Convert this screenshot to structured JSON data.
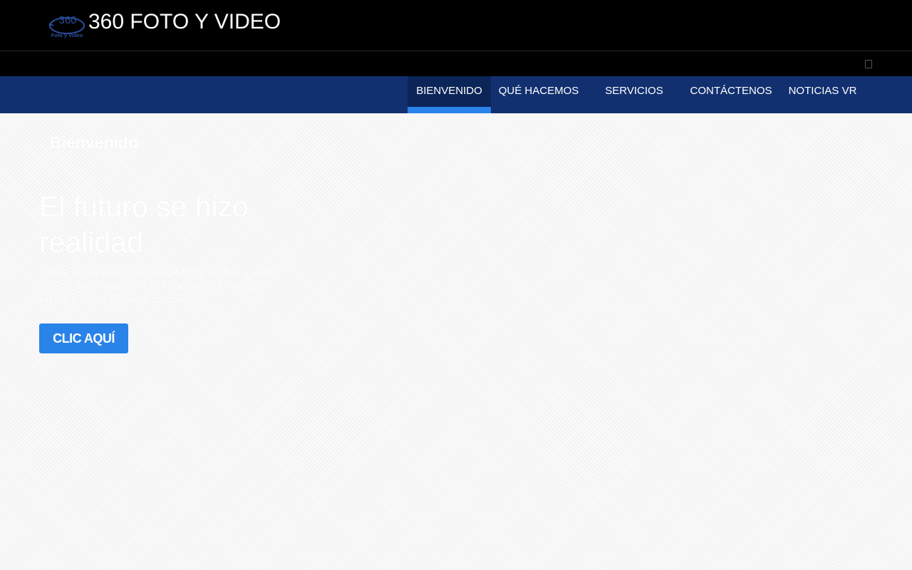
{
  "header": {
    "logo_text": "360",
    "logo_subtext": "Foto y Video",
    "site_title": "360 FOTO Y VIDEO"
  },
  "nav": {
    "items": [
      {
        "label": "BIENVENIDO",
        "active": true
      },
      {
        "label": "QUÉ HACEMOS",
        "active": false
      },
      {
        "label": "SERVICIOS",
        "active": false
      },
      {
        "label": "CONTÁCTENOS",
        "active": false
      },
      {
        "label": "NOTICIAS VR",
        "active": false
      }
    ]
  },
  "hero": {
    "section_label": "Bienvenido",
    "heading": "El futuro se hizo realidad",
    "text": "Utiliza la nueva tecnología de fotos en 360 y video en 360 para hacer crecer tu negocio de forma rápida y lograr el mejor branding",
    "button_label": "CLIC AQUÍ"
  },
  "colors": {
    "topbar": "#000000",
    "navbar": "#123070",
    "nav_active": "#0c2558",
    "accent": "#2a83e8",
    "logo_blue": "#2b4c9c"
  }
}
